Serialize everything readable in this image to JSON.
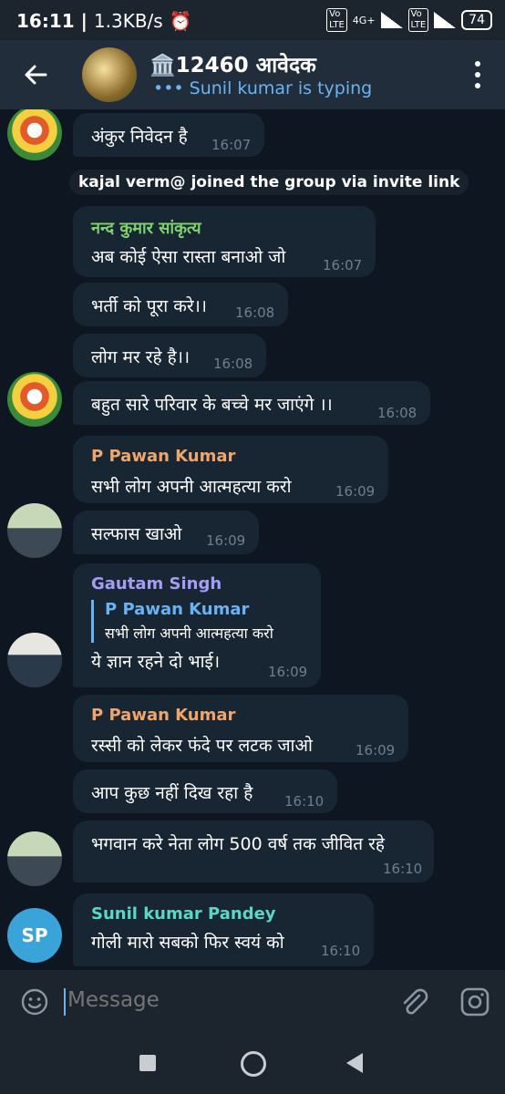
{
  "status": {
    "time": "16:11",
    "speed": "1.3KB/s",
    "battery": "74",
    "network": "4G+"
  },
  "header": {
    "title": "🏛️12460 आवेदक",
    "subtitle": "••• Sunil kumar is typing"
  },
  "service_message": "kajal verm@ joined the group via invite link",
  "messages": [
    {
      "text": "अंकुर निवेदन है",
      "time": "16:07"
    },
    {
      "sender": "नन्द कुमार सांकृत्य",
      "text": "अब कोई ऐसा रास्ता बनाओ जो",
      "time": "16:07"
    },
    {
      "text": "भर्ती को पूरा करे।।",
      "time": "16:08"
    },
    {
      "text": "लोग मर रहे है।।",
      "time": "16:08"
    },
    {
      "text": "बहुत सारे परिवार के बच्चे मर जाएंगे ।।",
      "time": "16:08"
    },
    {
      "sender": "P Pawan Kumar",
      "text": "सभी लोग अपनी आत्महत्या करो",
      "time": "16:09"
    },
    {
      "text": "सल्फास खाओ",
      "time": "16:09"
    },
    {
      "sender": "Gautam Singh",
      "reply_name": "P Pawan Kumar",
      "reply_text": "सभी लोग अपनी आत्महत्या करो",
      "text": "ये ज्ञान रहने दो भाई।",
      "time": "16:09"
    },
    {
      "sender": "P Pawan Kumar",
      "text": "रस्सी को लेकर फंदे पर लटक जाओ",
      "time": "16:09"
    },
    {
      "text": "आप कुछ नहीं दिख रहा है",
      "time": "16:10"
    },
    {
      "text": "भगवान करे नेता लोग 500 वर्ष तक जीवित रहे",
      "time": "16:10"
    },
    {
      "sender": "Sunil kumar Pandey",
      "text": "गोली मारो सबको फिर स्वयं को",
      "time": "16:10"
    }
  ],
  "avatar_initials": "SP",
  "composer": {
    "placeholder": "Message"
  },
  "colors": {
    "background": "#0e1621",
    "bubble": "#182533",
    "header": "#212d3b",
    "accent": "#6ab3f3",
    "name_green": "#7fd36f",
    "name_orange": "#f0a56a",
    "name_purple": "#a79cf4",
    "name_teal": "#5cd6c6"
  }
}
